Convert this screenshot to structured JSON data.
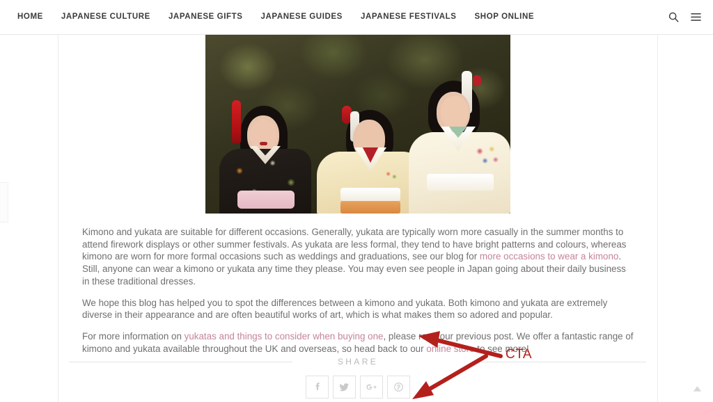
{
  "header": {
    "nav_items": [
      {
        "label": "HOME",
        "name": "nav-home"
      },
      {
        "label": "JAPANESE CULTURE",
        "name": "nav-japanese-culture"
      },
      {
        "label": "JAPANESE GIFTS",
        "name": "nav-japanese-gifts"
      },
      {
        "label": "JAPANESE GUIDES",
        "name": "nav-japanese-guides"
      },
      {
        "label": "JAPANESE FESTIVALS",
        "name": "nav-japanese-festivals"
      },
      {
        "label": "SHOP ONLINE",
        "name": "nav-shop-online"
      }
    ],
    "search_icon": "search-icon",
    "menu_icon": "hamburger-menu-icon"
  },
  "featured_image": {
    "alt": "Three women wearing traditional Japanese kimono with floral hair ornaments outdoors"
  },
  "article": {
    "paragraph_1": {
      "part_1": "Kimono and yukata are suitable for different occasions. Generally, yukata are typically worn more casually in the summer months to attend firework displays or other summer festivals. As yukata are less formal, they tend to have bright patterns and colours, whereas kimono are worn for more formal occasions such as weddings and graduations, see our blog for ",
      "link": "more occasions to wear a kimono",
      "part_2": ". Still, anyone can wear a kimono or yukata any time they please. You may even see people in Japan going about their daily business in these traditional dresses."
    },
    "paragraph_2": {
      "text": "We hope this blog has helped you to spot the differences between a kimono and yukata. Both kimono and yukata are extremely diverse in their appearance and are often beautiful works of art, which is what makes them so adored and popular."
    },
    "paragraph_3": {
      "part_1": "For more information on ",
      "link_1": "yukatas and things to consider when buying one",
      "part_2": ", please read our previous post. We offer a fantastic range of kimono and yukata available throughout the UK and overseas, so head back to our ",
      "link_2": "online store",
      "part_3": " to see more!"
    }
  },
  "share": {
    "label": "SHARE",
    "buttons": [
      {
        "name": "share-facebook-button",
        "glyph": "f",
        "title": "Facebook"
      },
      {
        "name": "share-twitter-button",
        "glyph": "twitter-icon",
        "title": "Twitter"
      },
      {
        "name": "share-googleplus-button",
        "glyph": "G+",
        "title": "Google Plus"
      },
      {
        "name": "share-pinterest-button",
        "glyph": "pinterest-icon",
        "title": "Pinterest"
      }
    ]
  },
  "annotations": {
    "cta_label": "CTA",
    "cta_color": "#b4201c",
    "arrows": [
      {
        "name": "arrow-to-online-store",
        "points_to": "online store link"
      },
      {
        "name": "arrow-to-share-buttons",
        "points_to": "pinterest share button"
      }
    ]
  },
  "back_to_top": {
    "icon": "chevron-up-icon"
  },
  "colors": {
    "link": "#c4849a",
    "body_text": "#6f6f6f",
    "nav_text": "#3a3a3a",
    "annotation_red": "#b4201c",
    "rule": "#e4e4e4"
  }
}
